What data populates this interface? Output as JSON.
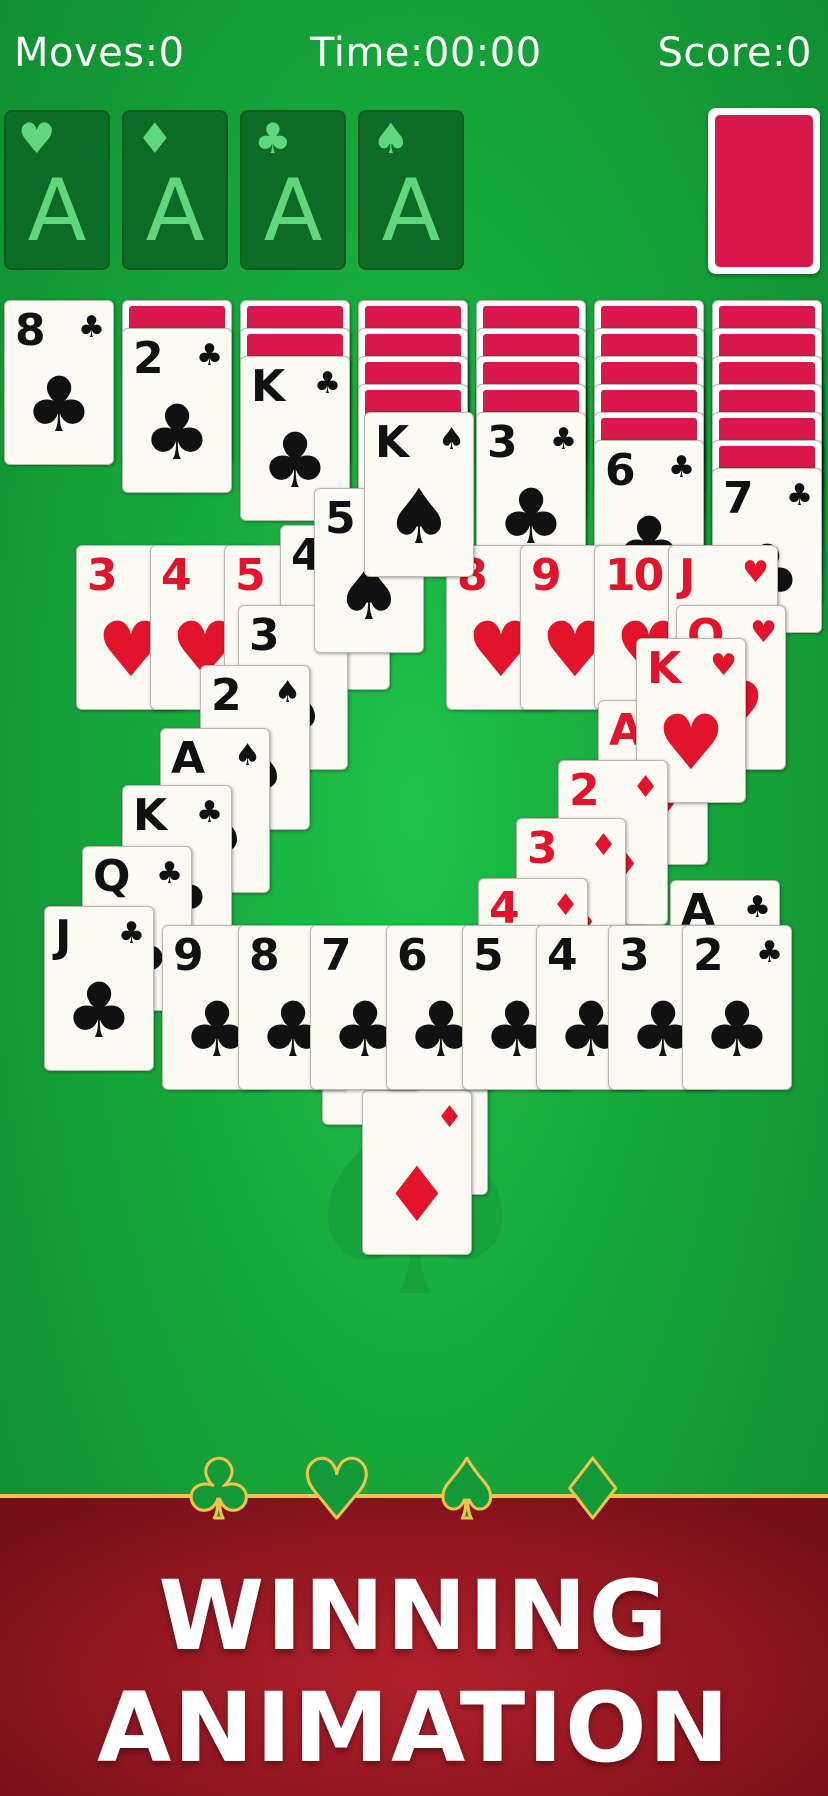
{
  "hud": {
    "moves": "Moves:0",
    "time": "Time:00:00",
    "score": "Score:0"
  },
  "foundations": [
    {
      "suit": "♥",
      "rank": "A",
      "icon": "heart-icon"
    },
    {
      "suit": "♦",
      "rank": "A",
      "icon": "diamond-icon"
    },
    {
      "suit": "♣",
      "rank": "A",
      "icon": "club-icon"
    },
    {
      "suit": "♠",
      "rank": "A",
      "icon": "spade-icon"
    }
  ],
  "tableau_cards": [
    {
      "rank": "3",
      "suit": "♥"
    },
    {
      "rank": "4",
      "suit": "♥"
    },
    {
      "rank": "5",
      "suit": "♥"
    },
    {
      "rank": "4",
      "suit": "♠"
    },
    {
      "rank": "8",
      "suit": "♥"
    },
    {
      "rank": "9",
      "suit": "♥"
    },
    {
      "rank": "10",
      "suit": "♥"
    },
    {
      "rank": "J",
      "suit": "♥"
    },
    {
      "rank": "Q",
      "suit": "♥"
    },
    {
      "rank": "3",
      "suit": "♠"
    },
    {
      "rank": "K",
      "suit": "♥"
    },
    {
      "rank": "A",
      "suit": "♦"
    },
    {
      "rank": "2",
      "suit": "♠"
    },
    {
      "rank": "A",
      "suit": "♠"
    },
    {
      "rank": "2",
      "suit": "♦"
    },
    {
      "rank": "K",
      "suit": "♣"
    },
    {
      "rank": "3",
      "suit": "♦"
    },
    {
      "rank": "Q",
      "suit": "♣"
    },
    {
      "rank": "4",
      "suit": "♦"
    },
    {
      "rank": "A",
      "suit": "♣"
    },
    {
      "rank": "J",
      "suit": "♣"
    },
    {
      "rank": "9",
      "suit": "♣"
    },
    {
      "rank": "8",
      "suit": "♣"
    },
    {
      "rank": "7",
      "suit": "♣"
    },
    {
      "rank": "6",
      "suit": "♣"
    },
    {
      "rank": "5",
      "suit": "♣"
    },
    {
      "rank": "4",
      "suit": "♣"
    },
    {
      "rank": "3",
      "suit": "♣"
    },
    {
      "rank": "2",
      "suit": "♣"
    },
    {
      "rank": "",
      "suit": "♦"
    },
    {
      "rank": "",
      "suit": "♦"
    },
    {
      "rank": "",
      "suit": "♦"
    },
    {
      "rank": "8",
      "suit": "♣"
    },
    {
      "rank": "2",
      "suit": "♣"
    },
    {
      "rank": "K",
      "suit": "♣"
    },
    {
      "rank": "5",
      "suit": "♠"
    },
    {
      "rank": "K",
      "suit": "♠"
    },
    {
      "rank": "3",
      "suit": "♣"
    },
    {
      "rank": "6",
      "suit": "♣"
    },
    {
      "rank": "7",
      "suit": "♣"
    },
    {
      "rank": "5",
      "suit": "♠"
    }
  ],
  "banner": {
    "line1": "WINNING",
    "line2": "ANIMATION",
    "icons": [
      "♣",
      "♥",
      "♠",
      "♦"
    ]
  },
  "colors": {
    "felt": "#16a83c",
    "card_back": "#d8174a",
    "banner": "#8c1520",
    "gold": "#f0c448",
    "red_suit": "#e2132a"
  }
}
